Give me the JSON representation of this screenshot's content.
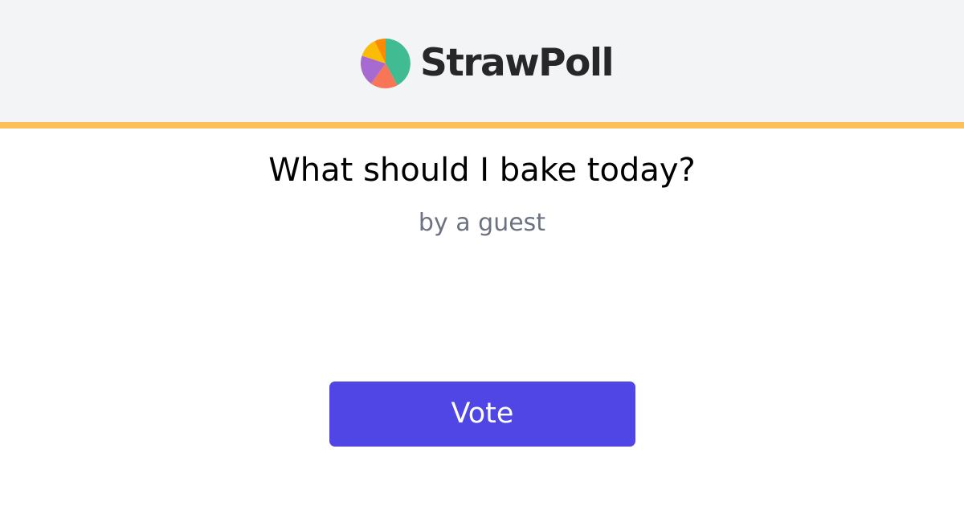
{
  "header": {
    "logo_text": "StrawPoll",
    "logo_icon": "pie-chart-icon",
    "background": "#f3f4f6",
    "accent_color": "#fbbf5b",
    "logo_slice_colors": [
      "#41bb91",
      "#f97558",
      "#a66ad1",
      "#fbbc05",
      "#fb8b07"
    ]
  },
  "poll": {
    "question": "What should I bake today?",
    "author_line": "by a guest"
  },
  "actions": {
    "vote_label": "Vote",
    "vote_color": "#4f46e5"
  }
}
